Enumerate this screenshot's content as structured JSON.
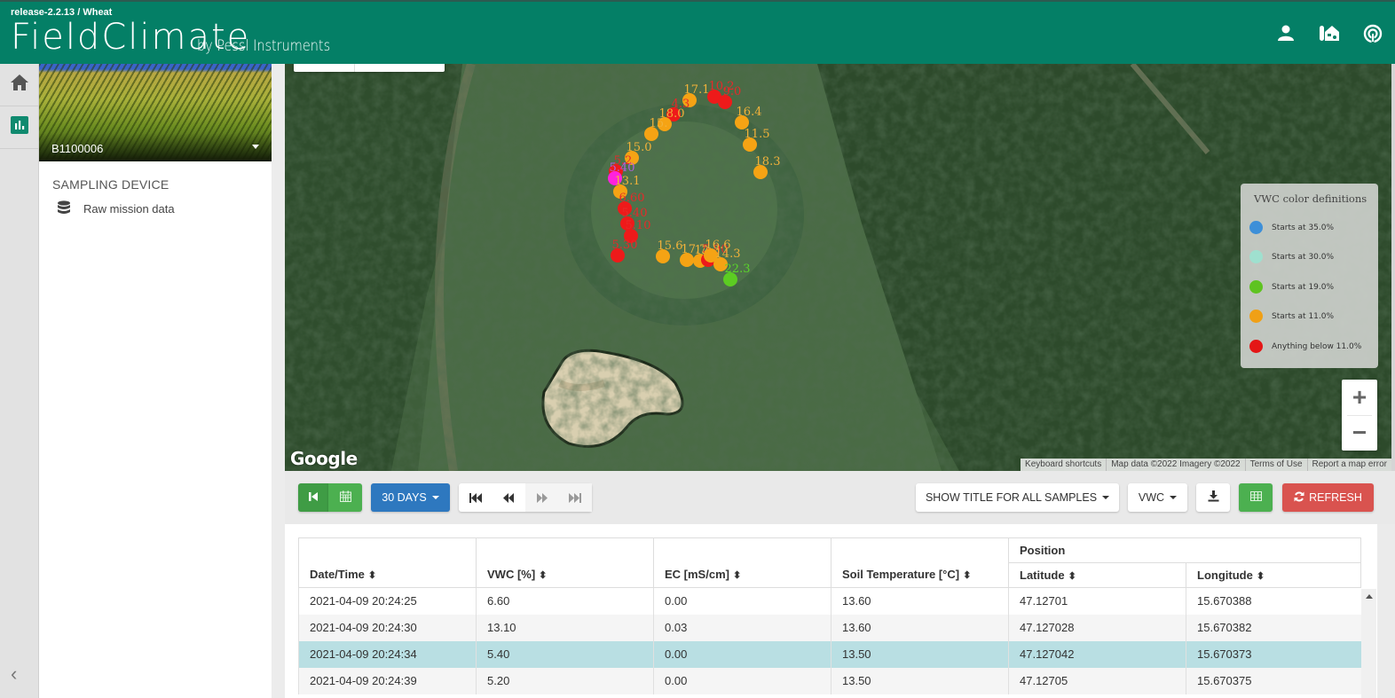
{
  "header": {
    "release": "release-2.2.13 / Wheat",
    "brand_main": "FieldClimate",
    "brand_by": "by Pessl Instruments",
    "icons": [
      "user-icon",
      "farm-icon",
      "sensor-signal-icon"
    ],
    "color": "#047f66"
  },
  "rail": {
    "items": [
      {
        "name": "home-icon",
        "active": false
      },
      {
        "name": "chart-icon",
        "active": true
      }
    ],
    "collapse": "‹"
  },
  "station": {
    "id": "B1100006",
    "section_title": "SAMPLING DEVICE",
    "menu": [
      {
        "icon": "database-icon",
        "label": "Raw mission data"
      }
    ]
  },
  "map": {
    "legend": {
      "title": "VWC color definitions",
      "items": [
        {
          "label": "Starts at 35.0%",
          "color": "#3d8fd8"
        },
        {
          "label": "Starts at 30.0%",
          "color": "#9fe0cf"
        },
        {
          "label": "Starts at 19.0%",
          "color": "#5ec320"
        },
        {
          "label": "Starts at 11.0%",
          "color": "#f0a016"
        },
        {
          "label": "Anything below 11.0%",
          "color": "#e41616"
        }
      ]
    },
    "zoom_in": "+",
    "zoom_out": "−",
    "google_logo": "Google",
    "attribution": [
      "Keyboard shortcuts",
      "Map data ©2022 Imagery ©2022",
      "Terms of Use",
      "Report a map error"
    ],
    "markers": [
      {
        "label": "17.1",
        "cls": "orange"
      },
      {
        "label": "10.2",
        "cls": "red"
      },
      {
        "label": "9.0",
        "cls": "red"
      },
      {
        "label": "16.4",
        "cls": "orange"
      },
      {
        "label": "11.5",
        "cls": "orange"
      },
      {
        "label": "18.3",
        "cls": "orange"
      },
      {
        "label": "4.3",
        "cls": "red"
      },
      {
        "label": "18.0",
        "cls": "orange"
      },
      {
        "label": "15.",
        "cls": "orange"
      },
      {
        "label": "15.0",
        "cls": "orange"
      },
      {
        "label": "5.2",
        "cls": "red"
      },
      {
        "label": "5.40",
        "cls": "selected"
      },
      {
        "label": "13.1",
        "cls": "orange"
      },
      {
        "label": "6.60",
        "cls": "red"
      },
      {
        "label": "5.40",
        "cls": "red"
      },
      {
        "label": "5.10",
        "cls": "red"
      },
      {
        "label": "5.30",
        "cls": "red"
      },
      {
        "label": "15.6",
        "cls": "orange"
      },
      {
        "label": "17.7",
        "cls": "orange"
      },
      {
        "label": "12.3",
        "cls": "orange"
      },
      {
        "label": "5.90",
        "cls": "red"
      },
      {
        "label": "16.6",
        "cls": "orange"
      },
      {
        "label": "14.3",
        "cls": "orange"
      },
      {
        "label": "22.3",
        "cls": "green"
      }
    ]
  },
  "toolbar": {
    "first_icon": "skip-first-icon",
    "calendar_icon": "calendar-icon",
    "period": "30 DAYS",
    "nav": [
      "⏮",
      "⏪",
      "⏩",
      "⏭"
    ],
    "show_title": "SHOW TITLE FOR ALL SAMPLES",
    "metric": "VWC",
    "download_icon": "download-icon",
    "table_icon": "table-icon",
    "refresh": "REFRESH"
  },
  "table": {
    "group_header": "Position",
    "columns": [
      "Date/Time",
      "VWC [%]",
      "EC [mS/cm]",
      "Soil Temperature [°C]",
      "Latitude",
      "Longitude"
    ],
    "sort_glyph": "⬍",
    "rows": [
      {
        "datetime": "2021-04-09 20:24:25",
        "vwc": "6.60",
        "ec": "0.00",
        "soil_temp": "13.60",
        "lat": "47.12701",
        "lon": "15.670388",
        "state": "normal"
      },
      {
        "datetime": "2021-04-09 20:24:30",
        "vwc": "13.10",
        "ec": "0.03",
        "soil_temp": "13.60",
        "lat": "47.127028",
        "lon": "15.670382",
        "state": "striped"
      },
      {
        "datetime": "2021-04-09 20:24:34",
        "vwc": "5.40",
        "ec": "0.00",
        "soil_temp": "13.50",
        "lat": "47.127042",
        "lon": "15.670373",
        "state": "selected"
      },
      {
        "datetime": "2021-04-09 20:24:39",
        "vwc": "5.20",
        "ec": "0.00",
        "soil_temp": "13.50",
        "lat": "47.12705",
        "lon": "15.670375",
        "state": "striped"
      }
    ]
  }
}
